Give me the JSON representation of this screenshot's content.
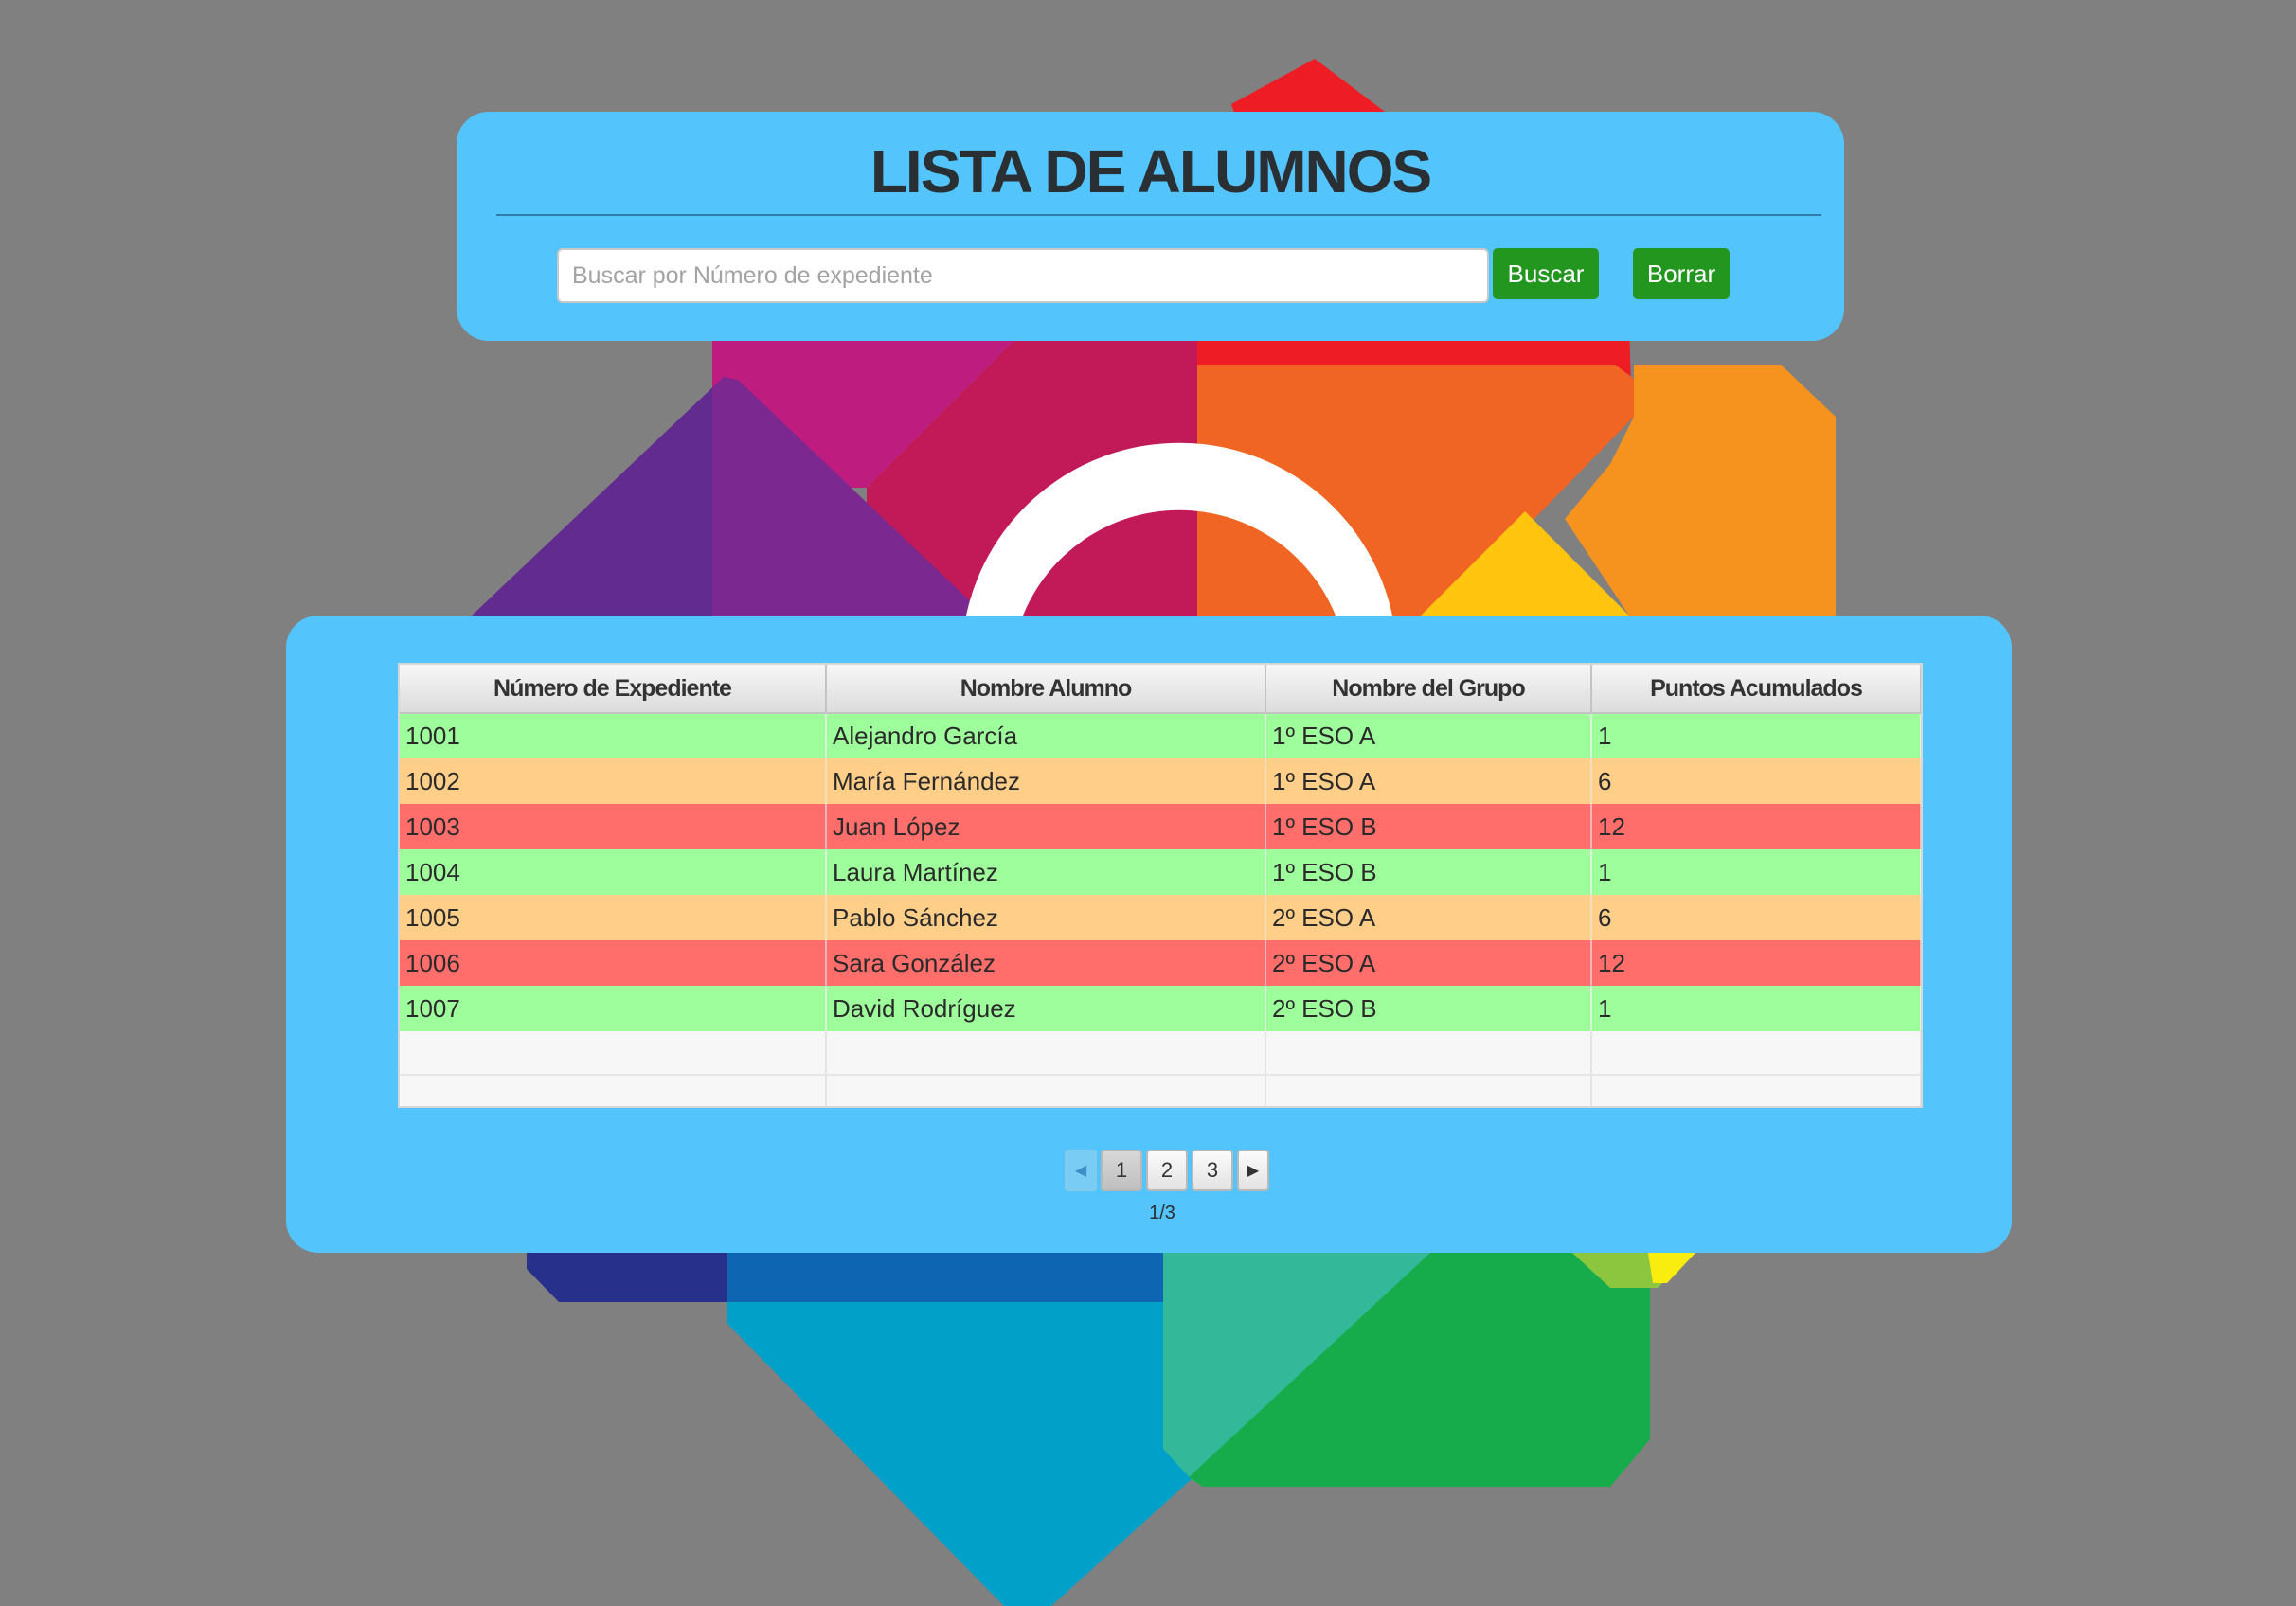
{
  "header": {
    "title": "LISTA DE ALUMNOS",
    "search_placeholder": "Buscar por Número de expediente",
    "search_value": "",
    "search_button": "Buscar",
    "clear_button": "Borrar"
  },
  "table": {
    "columns": [
      "Número de Expediente",
      "Nombre Alumno",
      "Nombre del Grupo",
      "Puntos Acumulados"
    ],
    "rows": [
      {
        "expediente": "1001",
        "nombre": "Alejandro García",
        "grupo": "1º ESO A",
        "puntos": "1",
        "status": "green"
      },
      {
        "expediente": "1002",
        "nombre": "María Fernández",
        "grupo": "1º ESO A",
        "puntos": "6",
        "status": "orange"
      },
      {
        "expediente": "1003",
        "nombre": "Juan López",
        "grupo": "1º ESO B",
        "puntos": "12",
        "status": "red"
      },
      {
        "expediente": "1004",
        "nombre": "Laura Martínez",
        "grupo": "1º ESO B",
        "puntos": "1",
        "status": "green"
      },
      {
        "expediente": "1005",
        "nombre": "Pablo Sánchez",
        "grupo": "2º ESO A",
        "puntos": "6",
        "status": "orange"
      },
      {
        "expediente": "1006",
        "nombre": "Sara González",
        "grupo": "2º ESO A",
        "puntos": "12",
        "status": "red"
      },
      {
        "expediente": "1007",
        "nombre": "David Rodríguez",
        "grupo": "2º ESO B",
        "puntos": "1",
        "status": "green"
      }
    ]
  },
  "pagination": {
    "pages": [
      "1",
      "2",
      "3"
    ],
    "current_page": 1,
    "label": "1/3",
    "prev_icon": "triangle-left-icon",
    "next_icon": "triangle-right-icon"
  },
  "colors": {
    "panel": "#54c5fc",
    "background": "#808080",
    "button": "#23961f",
    "row_green": "#9ffe9c",
    "row_orange": "#ffce88",
    "row_red": "#ff6e6b"
  }
}
